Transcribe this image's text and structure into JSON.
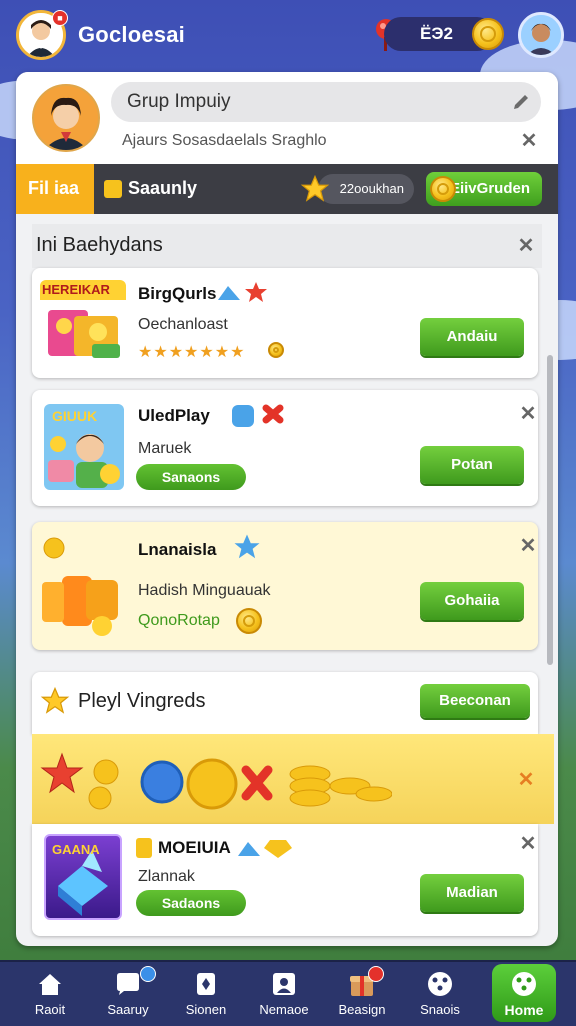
{
  "header": {
    "title": "Gocloesai",
    "currency": "ЁЭ2",
    "avatar_badge": "■"
  },
  "profile": {
    "search_text": "Grup Impuiy",
    "subtitle": "Ajaurs Sosasdaelals Sraghlo"
  },
  "tabs": {
    "active": "Fil iaa",
    "second": "Saaunly",
    "pill": "22ooukhan",
    "button": "EiivGruden"
  },
  "section1": {
    "title": "Ini Baehydans",
    "items": [
      {
        "thumb_label": "HEREIKAR",
        "title": "BirgQurls",
        "subtitle": "Oechanloast",
        "button": "Andaiu"
      },
      {
        "thumb_label": "GIUUK",
        "title": "UledPlay",
        "subtitle": "Maruek",
        "pill": "Sanaons",
        "button": "Potan"
      },
      {
        "title": "Lnanaisla",
        "subtitle": "Hadish Minguauak",
        "tag": "QonoRotap",
        "button": "Gohaiia"
      }
    ]
  },
  "section2": {
    "title": "Pleyl Vingreds",
    "button": "Beeconan",
    "item": {
      "thumb_label": "GAANA",
      "title": "MOEIUIA",
      "subtitle": "Zlannak",
      "pill": "Sadaons",
      "button": "Madian"
    }
  },
  "nav": [
    {
      "label": "Raoit"
    },
    {
      "label": "Saaruy"
    },
    {
      "label": "Sionen"
    },
    {
      "label": "Nemaoe"
    },
    {
      "label": "Beasign"
    },
    {
      "label": "Snaois"
    },
    {
      "label": "Home"
    }
  ],
  "colors": {
    "accent_green": "#3f9a1d",
    "accent_yellow": "#f8b11c",
    "nav_bg": "#2b356b"
  }
}
